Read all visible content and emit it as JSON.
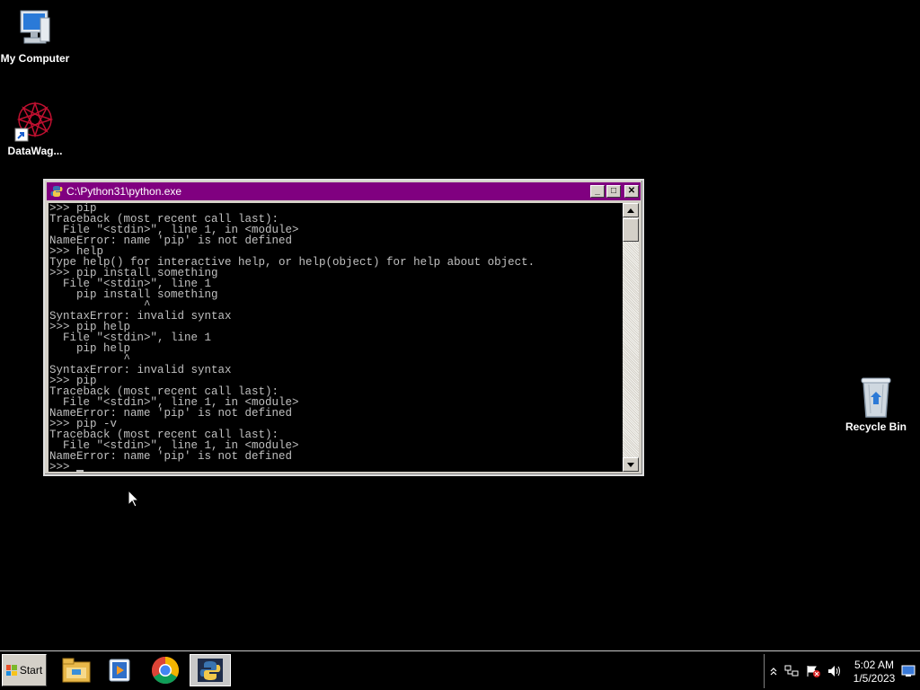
{
  "desktop": {
    "icons": [
      {
        "label": "My Computer",
        "icon": "computer-icon"
      },
      {
        "label": "DataWag...",
        "icon": "datawag-shortcut-icon"
      },
      {
        "label": "Recycle Bin",
        "icon": "recycle-bin-icon"
      }
    ]
  },
  "console_window": {
    "title": "C:\\Python31\\python.exe",
    "buttons": {
      "minimize": "_",
      "maximize": "□",
      "close": "✕"
    },
    "lines": [
      ">>> pip",
      "Traceback (most recent call last):",
      "  File \"<stdin>\", line 1, in <module>",
      "NameError: name 'pip' is not defined",
      ">>> help",
      "Type help() for interactive help, or help(object) for help about object.",
      ">>> pip install something",
      "  File \"<stdin>\", line 1",
      "    pip install something",
      "              ^",
      "SyntaxError: invalid syntax",
      ">>> pip help",
      "  File \"<stdin>\", line 1",
      "    pip help",
      "           ^",
      "SyntaxError: invalid syntax",
      ">>> pip",
      "Traceback (most recent call last):",
      "  File \"<stdin>\", line 1, in <module>",
      "NameError: name 'pip' is not defined",
      ">>> pip -v",
      "Traceback (most recent call last):",
      "  File \"<stdin>\", line 1, in <module>",
      "NameError: name 'pip' is not defined"
    ],
    "prompt": ">>> "
  },
  "taskbar": {
    "start_label": "Start",
    "apps": [
      {
        "name": "file-explorer-icon"
      },
      {
        "name": "media-player-icon"
      },
      {
        "name": "chrome-icon"
      },
      {
        "name": "python-icon",
        "active": true
      }
    ],
    "tray": {
      "time": "5:02 AM",
      "date": "1/5/2023"
    }
  },
  "colors": {
    "titlebar": "#800080",
    "desktop": "#000000",
    "console_text": "#c0c0c0"
  }
}
